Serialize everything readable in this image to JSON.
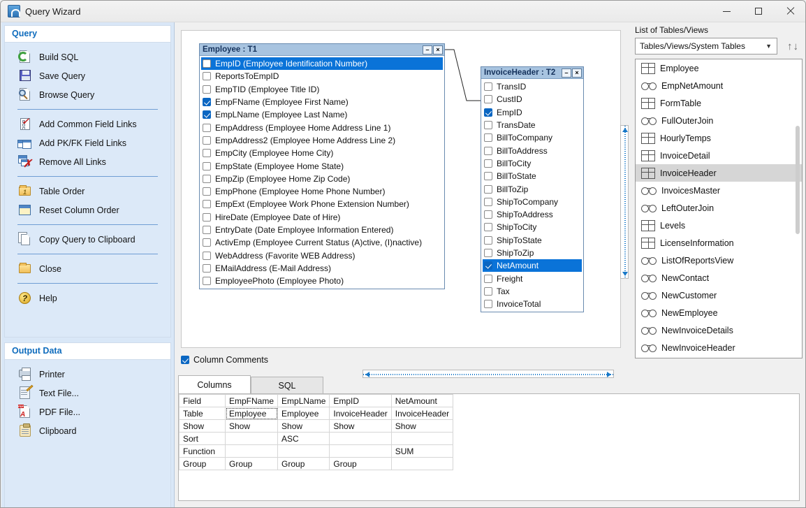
{
  "window": {
    "title": "Query Wizard",
    "app_icon": "query-wizard-icon",
    "minimize": "minimize-icon",
    "maximize": "maximize-icon",
    "close": "close-icon"
  },
  "sidebar": {
    "sections": [
      {
        "header": "Query",
        "groups": [
          [
            {
              "label": "Build SQL",
              "icon": "refresh-page-icon"
            },
            {
              "label": "Save Query",
              "icon": "floppy-disk-icon"
            },
            {
              "label": "Browse Query",
              "icon": "magnifier-icon"
            }
          ],
          [
            {
              "label": "Add Common Field Links",
              "icon": "checklist-icon"
            },
            {
              "label": "Add PK/FK Field Links",
              "icon": "two-tables-icon"
            },
            {
              "label": "Remove All Links",
              "icon": "remove-link-icon"
            }
          ],
          [
            {
              "label": "Table Order",
              "icon": "table-order-icon"
            },
            {
              "label": "Reset Column Order",
              "icon": "grid-icon"
            }
          ],
          [
            {
              "label": "Copy Query to Clipboard",
              "icon": "copy-icon"
            }
          ],
          [
            {
              "label": "Close",
              "icon": "open-folder-icon"
            }
          ],
          [
            {
              "label": "Help",
              "icon": "help-icon"
            }
          ]
        ]
      },
      {
        "header": "Output Data",
        "groups": [
          [
            {
              "label": "Printer",
              "icon": "printer-icon"
            },
            {
              "label": "Text File...",
              "icon": "text-file-icon"
            },
            {
              "label": "PDF File...",
              "icon": "pdf-file-icon"
            },
            {
              "label": "Clipboard",
              "icon": "clipboard-icon"
            }
          ]
        ]
      }
    ]
  },
  "canvas": {
    "column_comments": {
      "label": "Column Comments",
      "checked": true
    },
    "tables": [
      {
        "title": "Employee : T1",
        "minimize": "minimize-icon",
        "close": "close-icon",
        "fields": [
          {
            "name": "EmpID  (Employee Identification Number)",
            "checked": false,
            "selected": true
          },
          {
            "name": "ReportsToEmpID",
            "checked": false,
            "selected": false
          },
          {
            "name": "EmpTID  (Employee Title ID)",
            "checked": false,
            "selected": false
          },
          {
            "name": "EmpFName  (Employee First Name)",
            "checked": true,
            "selected": false
          },
          {
            "name": "EmpLName  (Employee Last Name)",
            "checked": true,
            "selected": false
          },
          {
            "name": "EmpAddress  (Employee Home Address Line 1)",
            "checked": false,
            "selected": false
          },
          {
            "name": "EmpAddress2  (Employee Home Address Line 2)",
            "checked": false,
            "selected": false
          },
          {
            "name": "EmpCity  (Employee Home City)",
            "checked": false,
            "selected": false
          },
          {
            "name": "EmpState  (Employee Home State)",
            "checked": false,
            "selected": false
          },
          {
            "name": "EmpZip  (Employee Home Zip Code)",
            "checked": false,
            "selected": false
          },
          {
            "name": "EmpPhone  (Employee Home Phone Number)",
            "checked": false,
            "selected": false
          },
          {
            "name": "EmpExt  (Employee Work Phone Extension Number)",
            "checked": false,
            "selected": false
          },
          {
            "name": "HireDate  (Employee Date of Hire)",
            "checked": false,
            "selected": false
          },
          {
            "name": "EntryDate  (Date Employee Information Entered)",
            "checked": false,
            "selected": false
          },
          {
            "name": "ActivEmp  (Employee Current Status (A)ctive, (I)nactive)",
            "checked": false,
            "selected": false
          },
          {
            "name": "WebAddress  (Favorite WEB Address)",
            "checked": false,
            "selected": false
          },
          {
            "name": "EMailAddress  (E-Mail Address)",
            "checked": false,
            "selected": false
          },
          {
            "name": "EmployeePhoto  (Employee Photo)",
            "checked": false,
            "selected": false
          }
        ]
      },
      {
        "title": "InvoiceHeader : T2",
        "minimize": "minimize-icon",
        "close": "close-icon",
        "fields": [
          {
            "name": "TransID",
            "checked": false,
            "selected": false
          },
          {
            "name": "CustID",
            "checked": false,
            "selected": false
          },
          {
            "name": "EmpID",
            "checked": true,
            "selected": false
          },
          {
            "name": "TransDate",
            "checked": false,
            "selected": false
          },
          {
            "name": "BillToCompany",
            "checked": false,
            "selected": false
          },
          {
            "name": "BillToAddress",
            "checked": false,
            "selected": false
          },
          {
            "name": "BillToCity",
            "checked": false,
            "selected": false
          },
          {
            "name": "BillToState",
            "checked": false,
            "selected": false
          },
          {
            "name": "BillToZip",
            "checked": false,
            "selected": false
          },
          {
            "name": "ShipToCompany",
            "checked": false,
            "selected": false
          },
          {
            "name": "ShipToAddress",
            "checked": false,
            "selected": false
          },
          {
            "name": "ShipToCity",
            "checked": false,
            "selected": false
          },
          {
            "name": "ShipToState",
            "checked": false,
            "selected": false
          },
          {
            "name": "ShipToZip",
            "checked": false,
            "selected": false
          },
          {
            "name": "NetAmount",
            "checked": true,
            "selected": true
          },
          {
            "name": "Freight",
            "checked": false,
            "selected": false
          },
          {
            "name": "Tax",
            "checked": false,
            "selected": false
          },
          {
            "name": "InvoiceTotal",
            "checked": false,
            "selected": false
          }
        ]
      }
    ]
  },
  "right_panel": {
    "label": "List of Tables/Views",
    "filter_value": "Tables/Views/System Tables",
    "sort_button": "sort-arrows-icon",
    "items": [
      {
        "label": "Employee",
        "icon": "table-icon",
        "selected": false
      },
      {
        "label": "EmpNetAmount",
        "icon": "view-icon",
        "selected": false
      },
      {
        "label": "FormTable",
        "icon": "table-icon",
        "selected": false
      },
      {
        "label": "FullOuterJoin",
        "icon": "view-icon",
        "selected": false
      },
      {
        "label": "HourlyTemps",
        "icon": "table-icon",
        "selected": false
      },
      {
        "label": "InvoiceDetail",
        "icon": "table-icon",
        "selected": false
      },
      {
        "label": "InvoiceHeader",
        "icon": "table-icon",
        "selected": true
      },
      {
        "label": "InvoicesMaster",
        "icon": "view-icon",
        "selected": false
      },
      {
        "label": "LeftOuterJoin",
        "icon": "view-icon",
        "selected": false
      },
      {
        "label": "Levels",
        "icon": "table-icon",
        "selected": false
      },
      {
        "label": "LicenseInformation",
        "icon": "table-icon",
        "selected": false
      },
      {
        "label": "ListOfReportsView",
        "icon": "view-icon",
        "selected": false
      },
      {
        "label": "NewContact",
        "icon": "view-icon",
        "selected": false
      },
      {
        "label": "NewCustomer",
        "icon": "view-icon",
        "selected": false
      },
      {
        "label": "NewEmployee",
        "icon": "view-icon",
        "selected": false
      },
      {
        "label": "NewInvoiceDetails",
        "icon": "view-icon",
        "selected": false
      },
      {
        "label": "NewInvoiceHeader",
        "icon": "view-icon",
        "selected": false
      }
    ]
  },
  "bottom": {
    "tabs": [
      {
        "label": "Columns",
        "active": true
      },
      {
        "label": "SQL",
        "active": false
      }
    ],
    "grid": {
      "rows": [
        {
          "head": "Field",
          "cells": [
            "EmpFName",
            "EmpLName",
            "EmpID",
            "NetAmount"
          ]
        },
        {
          "head": "Table",
          "cells": [
            "Employee",
            "Employee",
            "InvoiceHeader",
            "InvoiceHeader"
          ]
        },
        {
          "head": "Show",
          "cells": [
            "Show",
            "Show",
            "Show",
            "Show"
          ]
        },
        {
          "head": "Sort",
          "cells": [
            "",
            "ASC",
            "",
            ""
          ]
        },
        {
          "head": "Function",
          "cells": [
            "",
            "",
            "",
            "SUM"
          ]
        },
        {
          "head": "Group",
          "cells": [
            "Group",
            "Group",
            "Group",
            ""
          ]
        }
      ],
      "focused_cell": {
        "row": 1,
        "col": 0
      }
    }
  },
  "colors": {
    "accent": "#0a73d8",
    "sidebar_bg": "#d9e7f7",
    "section_header": "#0f6cbd",
    "table_title_bg": "#a8c4e0",
    "selection": "#0a73d8",
    "list_selection": "#d6d6d6"
  }
}
